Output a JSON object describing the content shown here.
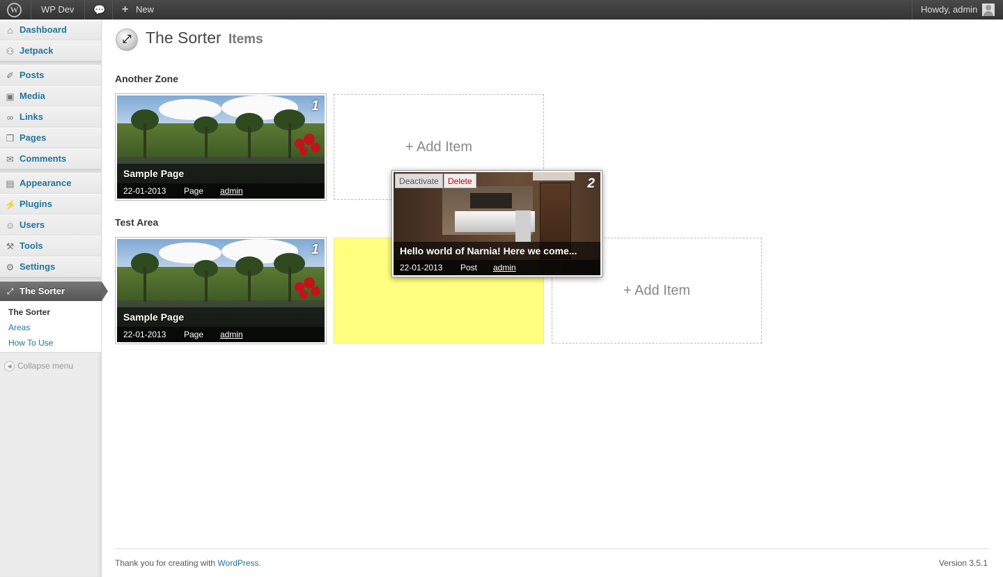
{
  "adminbar": {
    "site_name": "WP Dev",
    "new_label": "New",
    "howdy": "Howdy, admin"
  },
  "sidebar": {
    "items": [
      {
        "label": "Dashboard",
        "icon": "dashboard-icon"
      },
      {
        "label": "Jetpack",
        "icon": "jetpack-icon"
      },
      {
        "label": "Posts",
        "icon": "pin-icon"
      },
      {
        "label": "Media",
        "icon": "media-icon"
      },
      {
        "label": "Links",
        "icon": "link-icon"
      },
      {
        "label": "Pages",
        "icon": "pages-icon"
      },
      {
        "label": "Comments",
        "icon": "comment-icon"
      },
      {
        "label": "Appearance",
        "icon": "appearance-icon"
      },
      {
        "label": "Plugins",
        "icon": "plugin-icon"
      },
      {
        "label": "Users",
        "icon": "users-icon"
      },
      {
        "label": "Tools",
        "icon": "tools-icon"
      },
      {
        "label": "Settings",
        "icon": "settings-icon"
      }
    ],
    "current": {
      "label": "The Sorter",
      "icon": "arrows-icon"
    },
    "submenu": [
      "The Sorter",
      "Areas",
      "How To Use"
    ],
    "collapse": "Collapse menu"
  },
  "page": {
    "title": "The Sorter",
    "subtitle": "Items"
  },
  "zones": [
    {
      "title": "Another Zone",
      "card": {
        "number": "1",
        "title": "Sample Page",
        "date": "22-01-2013",
        "type": "Page",
        "author": "admin"
      },
      "add_label": "+ Add Item"
    },
    {
      "title": "Test Area",
      "card": {
        "number": "1",
        "title": "Sample Page",
        "date": "22-01-2013",
        "type": "Page",
        "author": "admin"
      },
      "add_label": "+ Add Item"
    }
  ],
  "dragged_card": {
    "number": "2",
    "title": "Hello world of Narnia! Here we come...",
    "date": "22-01-2013",
    "type": "Post",
    "author": "admin",
    "deactivate_label": "Deactivate",
    "delete_label": "Delete"
  },
  "footer": {
    "thanks_prefix": "Thank you for creating with",
    "thanks_link": "WordPress",
    "thanks_suffix": ".",
    "version": "Version 3.5.1"
  },
  "colors": {
    "link": "#21759b",
    "placeholder": "#ffff80",
    "adminbar": "#464646"
  }
}
